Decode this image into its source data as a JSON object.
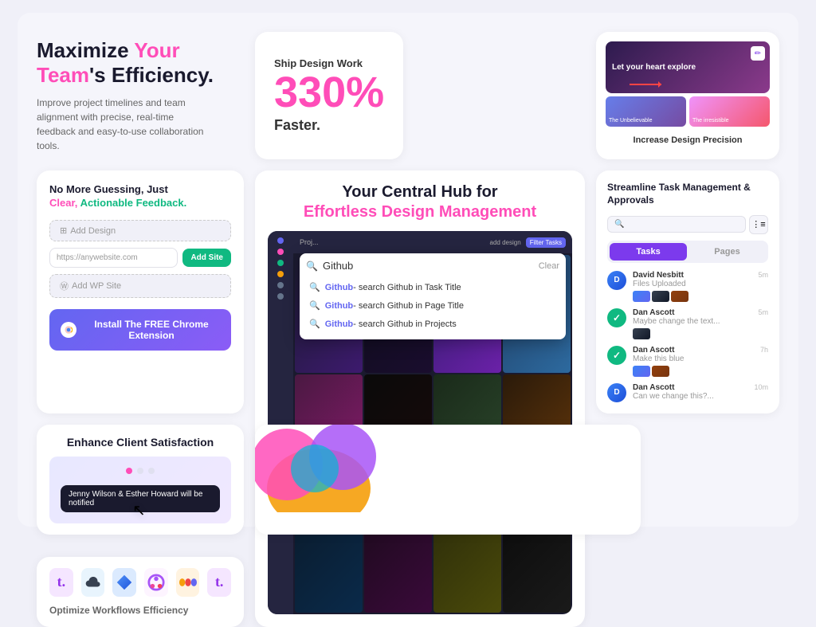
{
  "hero": {
    "title_part1": "Maximize ",
    "title_highlight1": "Your Team",
    "title_apostrophe": "'s Efficiency.",
    "description": "Improve project timelines and team alignment with precise, real-time feedback and easy-to-use collaboration tools."
  },
  "ship": {
    "label": "Ship Design Work",
    "percent": "330%",
    "faster": "Faster."
  },
  "precision": {
    "title": "Increase Design Precision",
    "main_img_text": "Let your heart explore",
    "thumb1_label": "The Unbelievable",
    "thumb2_label": "The irresistible"
  },
  "guessing": {
    "title": "No More Guessing, Just",
    "subtitle_pink": "Clear,",
    "subtitle_green": "Actionable Feedback.",
    "add_design_label": "Add Design",
    "url_placeholder": "https://anywebsite.com",
    "add_site_label": "Add Site",
    "add_wp_label": "Add WP Site",
    "chrome_btn_label": "Install The FREE Chrome Extension"
  },
  "hub": {
    "title": "Your Central Hub for",
    "subtitle": "Effortless Design Management",
    "search_placeholder": "Github",
    "clear_label": "Clear",
    "results": [
      "Github- search Github in Task Title",
      "Github- search Github in Page Title",
      "Github- search Github in Projects"
    ]
  },
  "streamline": {
    "title": "Streamline Task Management & Approvals",
    "tabs": [
      "Tasks",
      "Pages"
    ],
    "tasks": [
      {
        "name": "David Nesbitt",
        "desc": "Files Uploaded",
        "time": "5m"
      },
      {
        "name": "Dan Ascott",
        "desc": "Maybe change the text...",
        "time": "5m",
        "checked": true
      },
      {
        "name": "Dan Ascott",
        "desc": "Make this blue",
        "time": "7h",
        "checked": true
      },
      {
        "name": "Dan Ascott",
        "desc": "Can we change this?...",
        "time": "10m"
      }
    ]
  },
  "workflows": {
    "title": "Optimize Workflows Efficiency",
    "icons": [
      "t.",
      "☁",
      "◆",
      "●",
      "≡",
      "t."
    ]
  },
  "enhance": {
    "title": "Enhance Client Satisfaction",
    "notify_text": "Jenny Wilson & Esther Howard will be notified"
  }
}
